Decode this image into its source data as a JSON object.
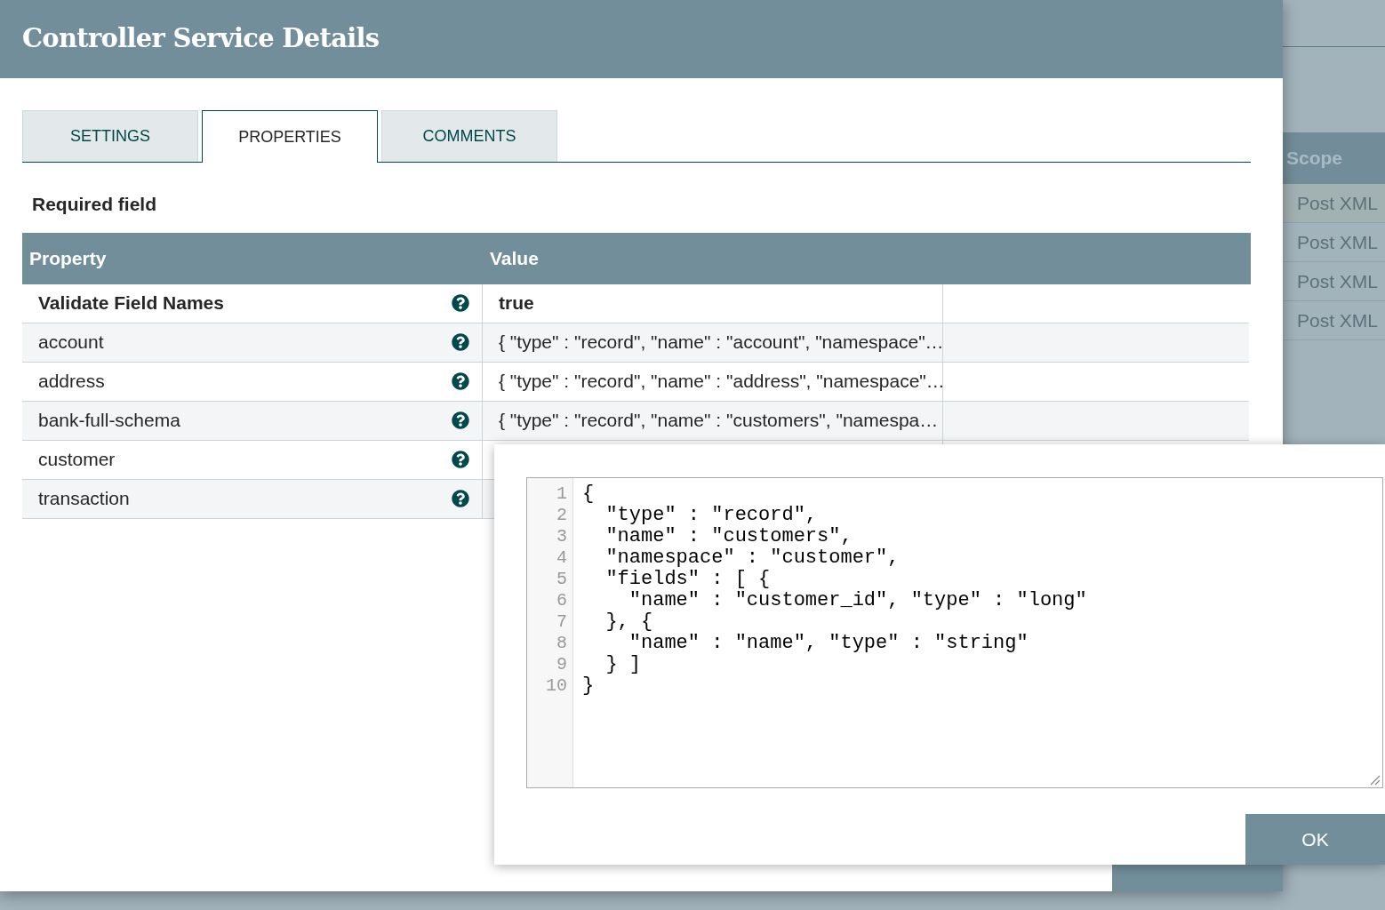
{
  "background": {
    "table": {
      "header": "Scope",
      "rows": [
        "Post XML",
        "Post XML",
        "Post XML",
        "Post XML"
      ]
    }
  },
  "dialog": {
    "title": "Controller Service Details",
    "tabs": [
      {
        "label": "SETTINGS",
        "selected": false
      },
      {
        "label": "PROPERTIES",
        "selected": true
      },
      {
        "label": "COMMENTS",
        "selected": false
      }
    ],
    "required_note": "Required field",
    "table": {
      "columns": [
        "Property",
        "Value"
      ],
      "rows": [
        {
          "property": "Validate Field Names",
          "required": true,
          "value": "true"
        },
        {
          "property": "account",
          "required": false,
          "value": "{ \"type\" : \"record\", \"name\" : \"account\", \"namespace\"…"
        },
        {
          "property": "address",
          "required": false,
          "value": "{ \"type\" : \"record\", \"name\" : \"address\", \"namespace\"…"
        },
        {
          "property": "bank-full-schema",
          "required": false,
          "value": "{ \"type\" : \"record\", \"name\" : \"customers\", \"namespa…"
        },
        {
          "property": "customer",
          "required": false
        },
        {
          "property": "transaction",
          "required": false
        }
      ]
    }
  },
  "editor": {
    "lines": [
      {
        "number": "1",
        "text": "{"
      },
      {
        "number": "2",
        "text": "  \"type\" : \"record\","
      },
      {
        "number": "3",
        "text": "  \"name\" : \"customers\","
      },
      {
        "number": "4",
        "text": "  \"namespace\" : \"customer\","
      },
      {
        "number": "5",
        "text": "  \"fields\" : [ {"
      },
      {
        "number": "6",
        "text": "    \"name\" : \"customer_id\", \"type\" : \"long\""
      },
      {
        "number": "7",
        "text": "  }, {"
      },
      {
        "number": "8",
        "text": "    \"name\" : \"name\", \"type\" : \"string\""
      },
      {
        "number": "9",
        "text": "  } ]"
      },
      {
        "number": "10",
        "text": "}"
      }
    ],
    "ok_button": "OK"
  }
}
